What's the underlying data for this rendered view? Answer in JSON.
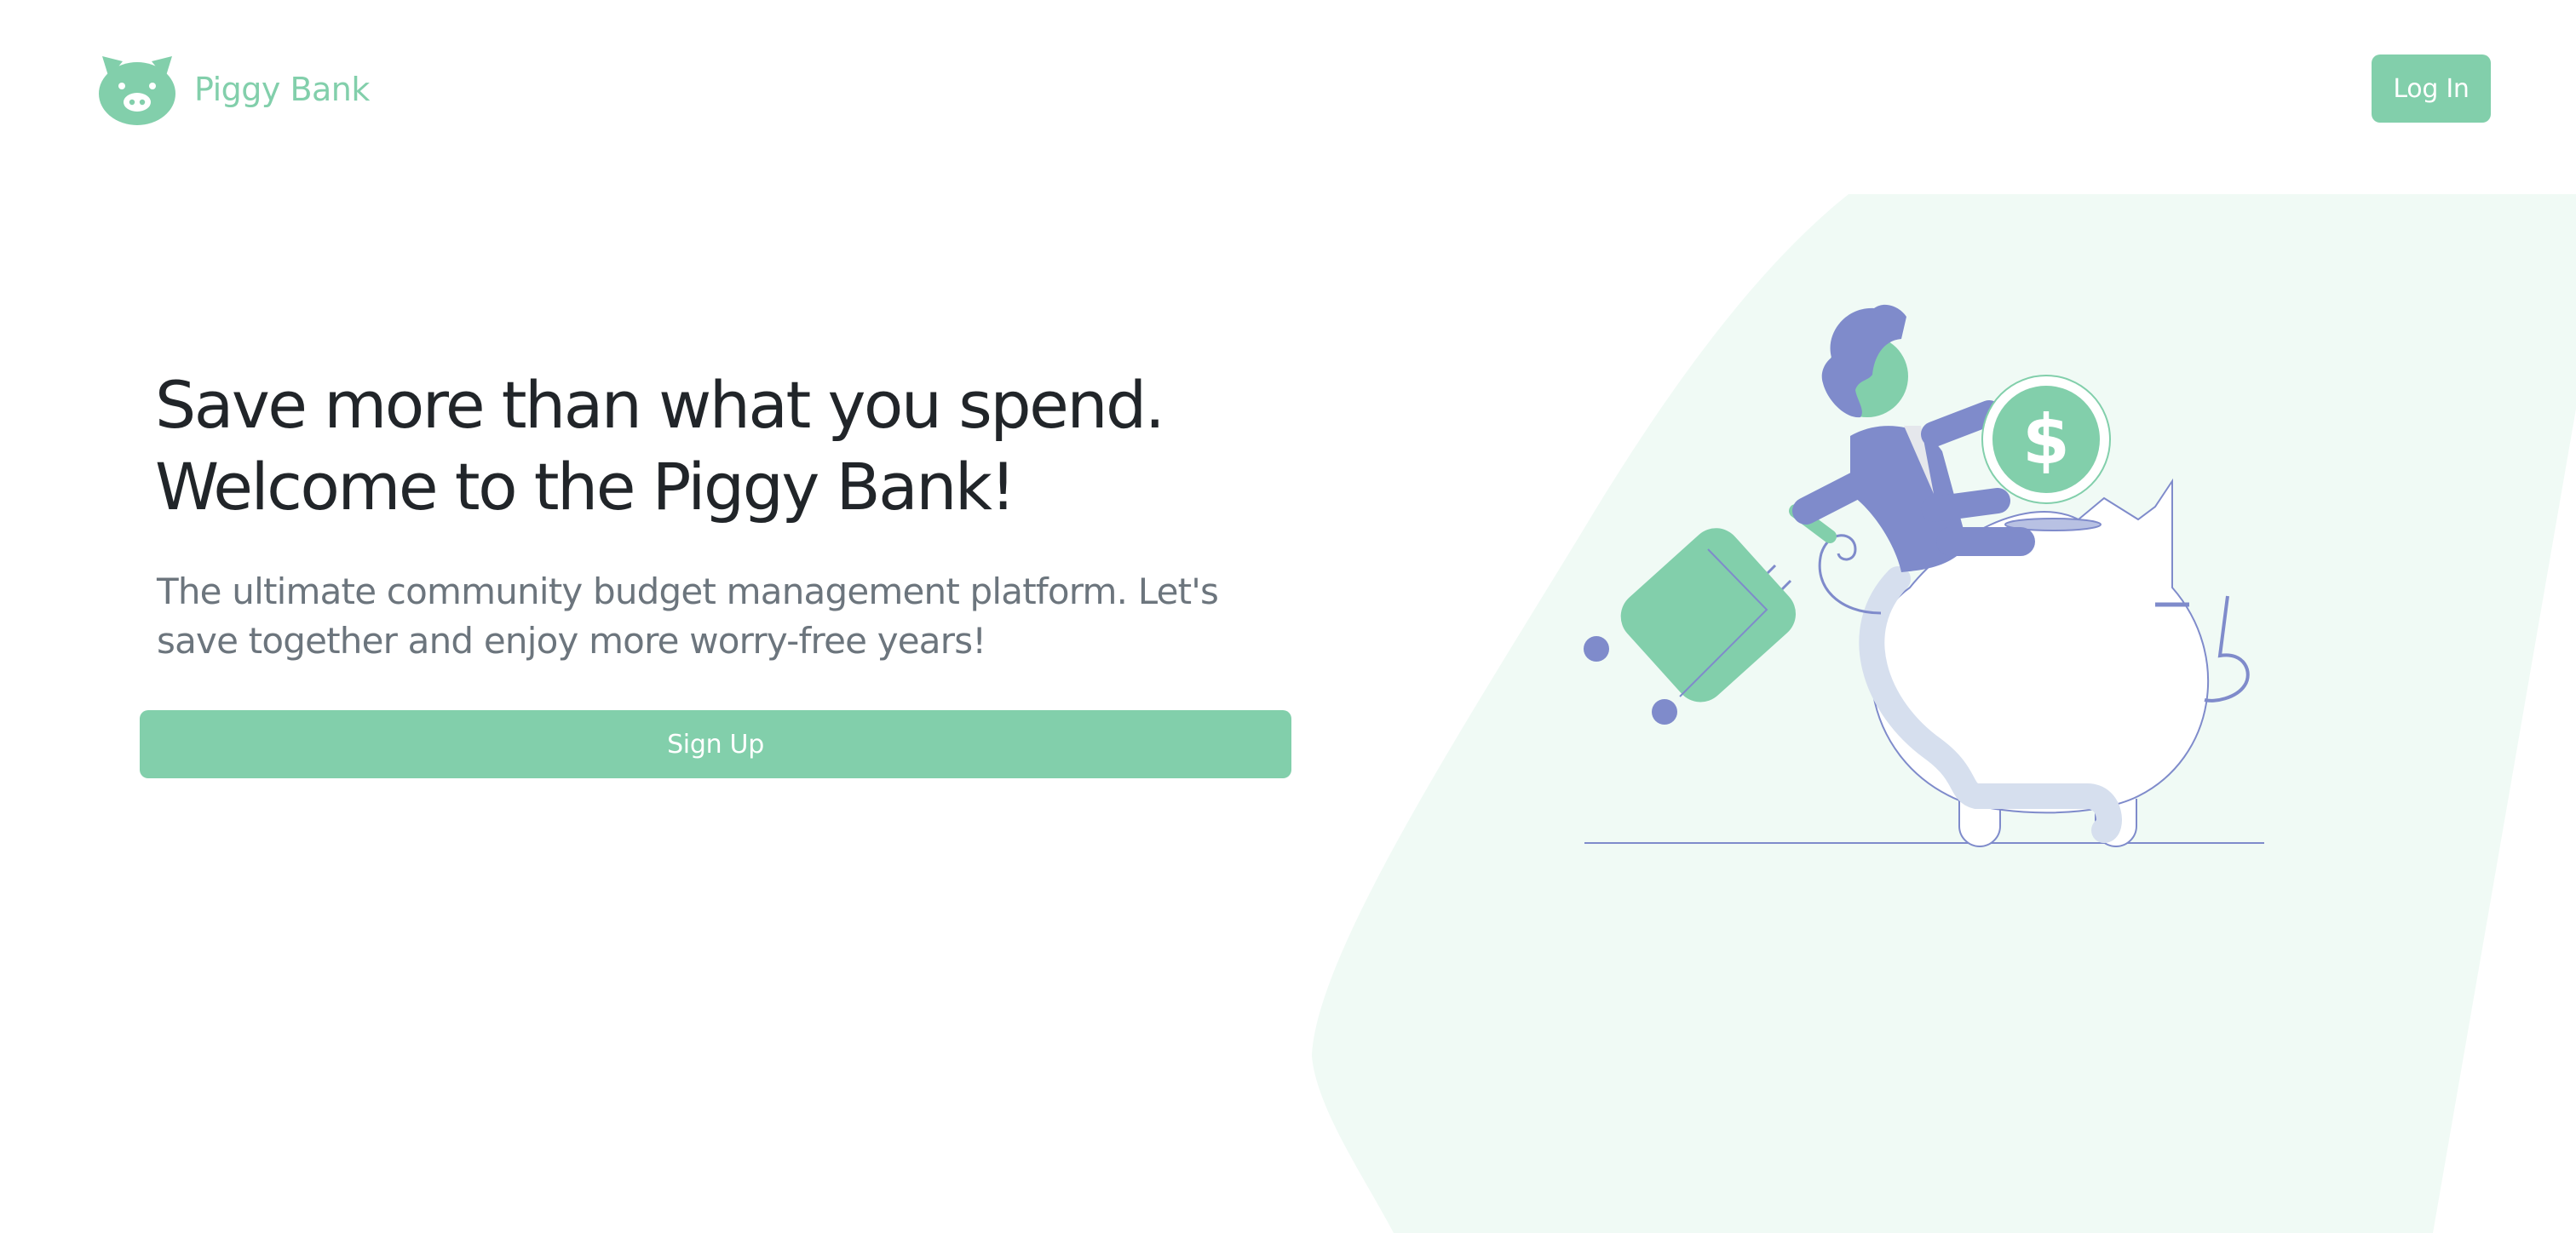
{
  "brand": {
    "name": "Piggy Bank",
    "logo_icon": "pig-face-icon"
  },
  "navbar": {
    "login_label": "Log In"
  },
  "hero": {
    "title_line1": "Save more than what you spend.",
    "title_line2": "Welcome to the Piggy Bank!",
    "subtitle": "The ultimate community budget management platform. Let's save together and enjoy more worry-free years!",
    "signup_label": "Sign Up"
  },
  "illustration": {
    "coin_symbol": "$",
    "description_icons": [
      "person-icon",
      "suitcase-icon",
      "coin-icon",
      "piggy-bank-icon"
    ]
  },
  "colors": {
    "accent": "#82cfab",
    "background_shape": "#f0faf5",
    "illustration_purple": "#7f8bcb",
    "heading_text": "#212529",
    "muted_text": "#6c757d"
  }
}
